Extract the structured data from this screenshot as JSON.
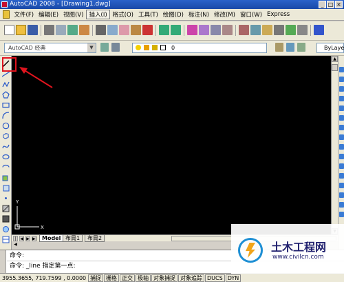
{
  "window": {
    "title": "AutoCAD 2008 - [Drawing1.dwg]",
    "buttons": [
      "_",
      "□",
      "×"
    ]
  },
  "menu": {
    "items": [
      "文件(F)",
      "编辑(E)",
      "视图(V)",
      "插入(I)",
      "格式(O)",
      "工具(T)",
      "绘图(D)",
      "标注(N)",
      "修改(M)",
      "窗口(W)",
      "Express"
    ],
    "active_index": 3
  },
  "toolbar2": {
    "workspace": "AutoCAD 经典",
    "workspace_arrow": "▼",
    "layer_value": "0",
    "linetype": "ByLayer"
  },
  "canvas": {
    "background": "#000000",
    "ucs": {
      "x_label": "X",
      "y_label": "Y"
    }
  },
  "tabs": {
    "nav": [
      "|◀",
      "◀",
      "▶",
      "▶|"
    ],
    "items": [
      "Model",
      "布局1",
      "布局2"
    ],
    "active_index": 0
  },
  "command": {
    "line1": "命令:",
    "line2": "命令: _line 指定第一点:"
  },
  "status": {
    "coords": "3955.3655, 719.7599 , 0.0000",
    "buttons": [
      "捕捉",
      "栅格",
      "正交",
      "极轴",
      "对象捕捉",
      "对象追踪",
      "DUCS",
      "DYN"
    ]
  },
  "colors": {
    "highlight": "#e0141e",
    "arrow": "#e0141e",
    "accent": "#2a62c9"
  },
  "watermark": {
    "title": "土木工程网",
    "url": "www.civilcn.com"
  },
  "icons": {
    "left_tools": [
      "line-icon",
      "construction-line-icon",
      "polyline-icon",
      "polygon-icon",
      "rectangle-icon",
      "arc-icon",
      "circle-icon",
      "revision-cloud-icon",
      "spline-icon",
      "ellipse-icon",
      "ellipse-arc-icon",
      "insert-block-icon",
      "make-block-icon",
      "point-icon",
      "hatch-icon",
      "gradient-icon",
      "region-icon",
      "table-icon",
      "multiline-text-icon"
    ]
  }
}
